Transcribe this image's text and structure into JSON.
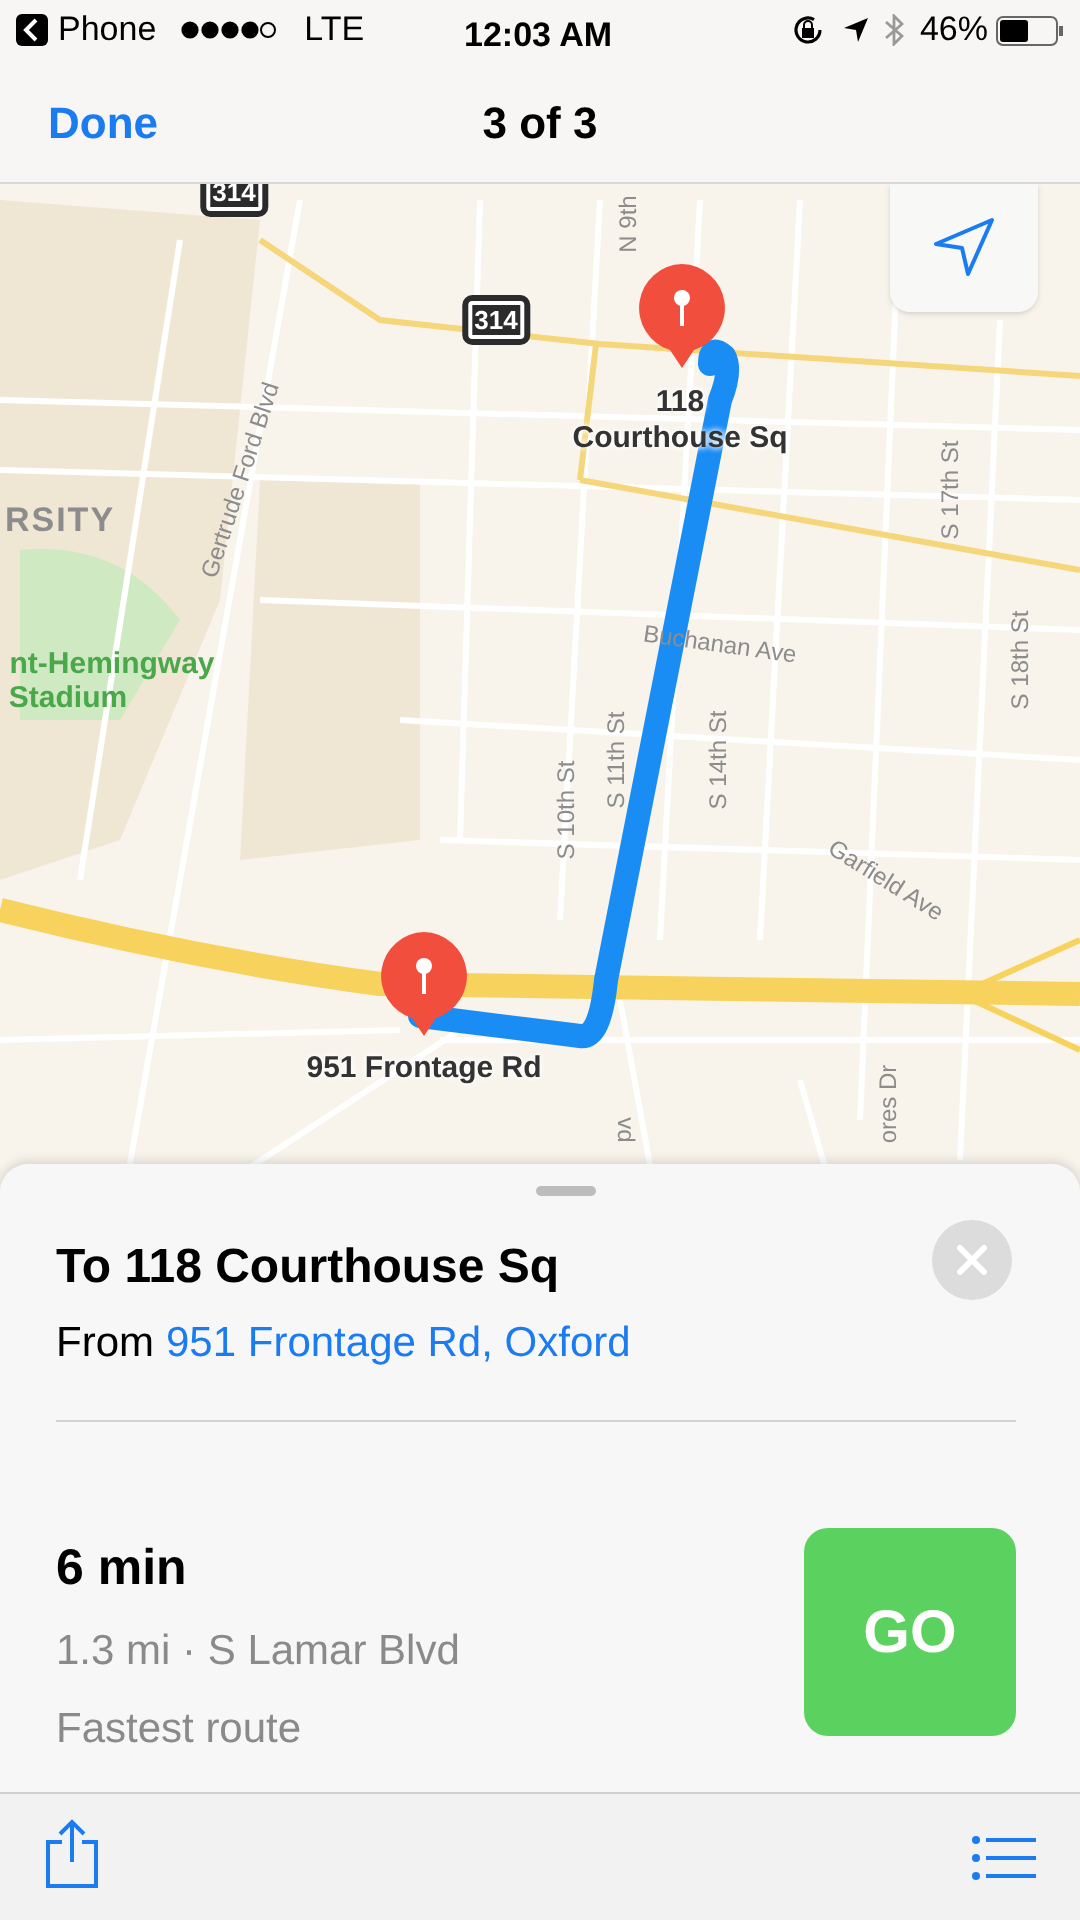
{
  "status_bar": {
    "back_label": "Phone",
    "carrier": "LTE",
    "time": "12:03 AM",
    "battery": "46%"
  },
  "nav_bar": {
    "done": "Done",
    "title": "3 of 3"
  },
  "map": {
    "labels": [
      {
        "text": "314",
        "kind": "shield"
      },
      {
        "text": "314",
        "kind": "shield"
      },
      {
        "text": "N 9th",
        "kind": "street"
      },
      {
        "text": "Gertrude Ford Blvd",
        "kind": "street"
      },
      {
        "text": "RSITY",
        "kind": "area"
      },
      {
        "text": "nt-Hemingway",
        "kind": "poi"
      },
      {
        "text": "Stadium",
        "kind": "poi"
      },
      {
        "text": "118",
        "kind": "pin"
      },
      {
        "text": "Courthouse Sq",
        "kind": "pin"
      },
      {
        "text": "S 17th St",
        "kind": "street"
      },
      {
        "text": "Buchanan Ave",
        "kind": "street"
      },
      {
        "text": "S 18th St",
        "kind": "street"
      },
      {
        "text": "S 11th St",
        "kind": "street"
      },
      {
        "text": "S 14th St",
        "kind": "street"
      },
      {
        "text": "S 10th St",
        "kind": "street"
      },
      {
        "text": "Garfield Ave",
        "kind": "street"
      },
      {
        "text": "951 Frontage Rd",
        "kind": "pin"
      },
      {
        "text": "vd",
        "kind": "street"
      },
      {
        "text": "ores Dr",
        "kind": "street"
      }
    ]
  },
  "card": {
    "title": "To 118 Courthouse Sq",
    "from_prefix": "From",
    "from_link": "951 Frontage Rd, Oxford",
    "duration": "6 min",
    "details": "1.3 mi · S Lamar Blvd",
    "note": "Fastest route",
    "go": "GO"
  }
}
